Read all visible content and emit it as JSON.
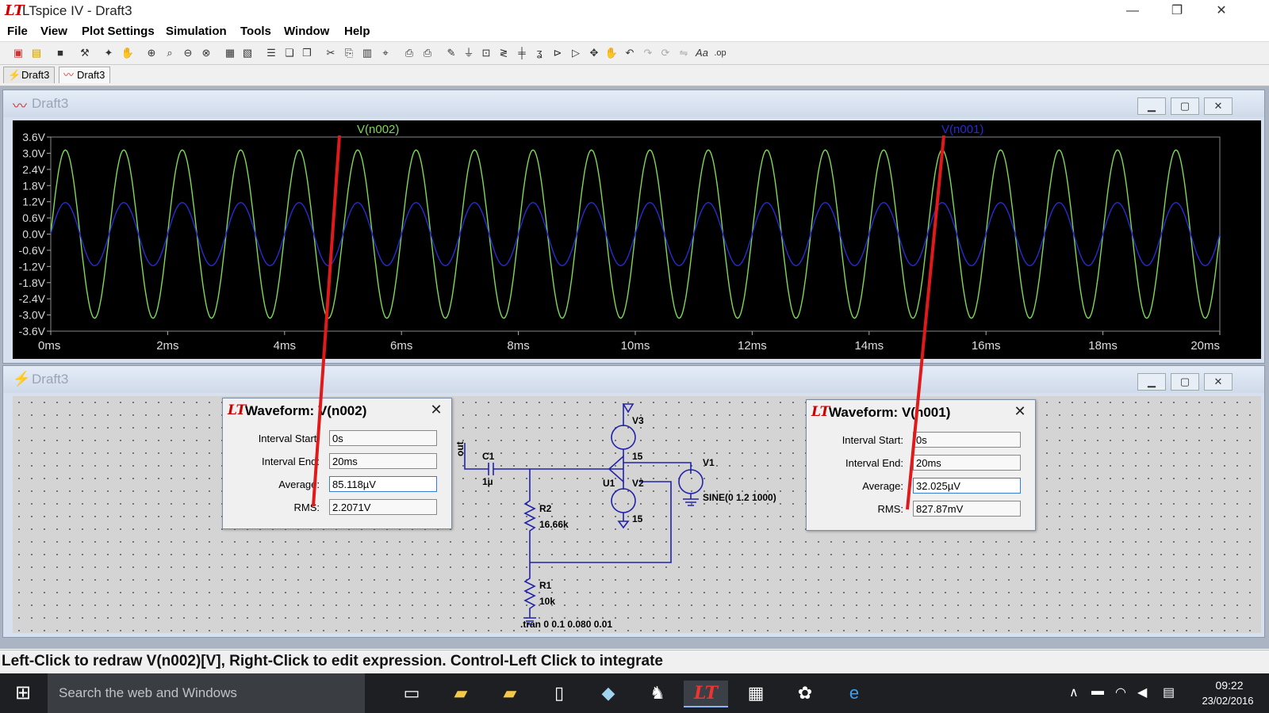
{
  "app": {
    "title": "LTspice IV - Draft3",
    "logo": "LT"
  },
  "window_controls": {
    "minimize": "—",
    "maximize": "❐",
    "close": "✕"
  },
  "menu": [
    "File",
    "View",
    "Plot Settings",
    "Simulation",
    "Tools",
    "Window",
    "Help"
  ],
  "tabs": [
    {
      "label": "Draft3",
      "icon": "schematic-icon"
    },
    {
      "label": "Draft3",
      "icon": "waveform-icon"
    }
  ],
  "plot_window": {
    "title": "Draft3"
  },
  "schematic_window": {
    "title": "Draft3"
  },
  "chart_data": {
    "type": "line",
    "xlabel_ticks": [
      "0ms",
      "2ms",
      "4ms",
      "6ms",
      "8ms",
      "10ms",
      "12ms",
      "14ms",
      "16ms",
      "18ms",
      "20ms"
    ],
    "ylabel_ticks": [
      "3.6V",
      "3.0V",
      "2.4V",
      "1.8V",
      "1.2V",
      "0.6V",
      "0.0V",
      "-0.6V",
      "-1.2V",
      "-1.8V",
      "-2.4V",
      "-3.0V",
      "-3.6V"
    ],
    "xlim": [
      0,
      20
    ],
    "ylim": [
      -3.6,
      3.6
    ],
    "x_unit": "ms",
    "series": [
      {
        "name": "V(n002)",
        "amplitude": 3.12,
        "frequency_khz": 1,
        "color": "#7ed957"
      },
      {
        "name": "V(n001)",
        "amplitude": 1.17,
        "frequency_khz": 1,
        "color": "#2a2ad0"
      }
    ],
    "background": "#000000"
  },
  "dialog1": {
    "title": "Waveform: V(n002)",
    "interval_start_label": "Interval Start:",
    "interval_start": "0s",
    "interval_end_label": "Interval End:",
    "interval_end": "20ms",
    "average_label": "Average:",
    "average": "85.118µV",
    "rms_label": "RMS:",
    "rms": "2.2071V"
  },
  "dialog2": {
    "title": "Waveform: V(n001)",
    "interval_start_label": "Interval Start:",
    "interval_start": "0s",
    "interval_end_label": "Interval End:",
    "interval_end": "20ms",
    "average_label": "Average:",
    "average": "32.025µV",
    "rms_label": "RMS:",
    "rms": "827.87mV"
  },
  "schematic": {
    "out": "out",
    "c1": "C1",
    "c1_val": "1µ",
    "r2": "R2",
    "r2_val": "16.66k",
    "r1": "R1",
    "r1_val": "10k",
    "v3": "V3",
    "v3_val": "15",
    "v2": "V2",
    "v2_val": "15",
    "u1": "U1",
    "v1": "V1",
    "v1_val": "SINE(0 1.2 1000)",
    "tran": ".tran 0 0.1 0.080 0.01"
  },
  "status": "Left-Click to redraw V(n002)[V],  Right-Click to edit expression. Control-Left Click to integrate",
  "taskbar": {
    "search": "Search the web and Windows",
    "time": "09:22",
    "date": "23/02/2016"
  },
  "accent": "#c00000"
}
